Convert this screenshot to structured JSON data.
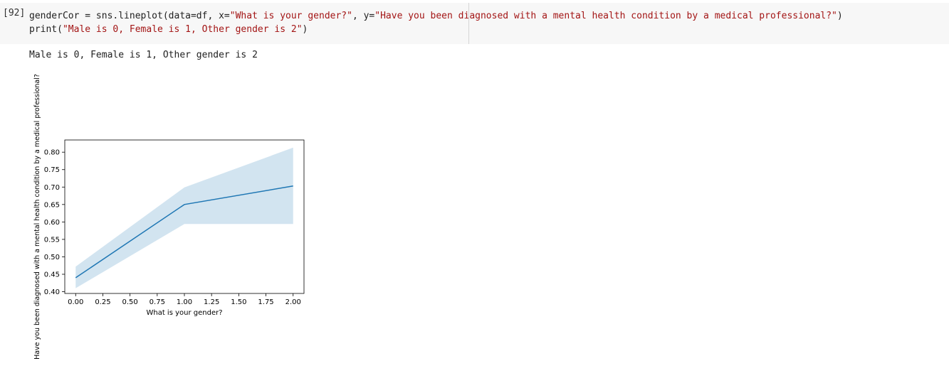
{
  "cell": {
    "prompt": "[92]",
    "code_line1_a": "genderCor = sns.lineplot(data=df, x=",
    "code_line1_b": "\"What is your gender?\"",
    "code_line1_c": ", y=",
    "code_line1_d": "\"Have you been diagnosed with a mental health condition by a medical professional?\"",
    "code_line1_e": ")",
    "code_line2_a": "print(",
    "code_line2_b": "\"Male is 0, Female is 1, Other gender is 2\"",
    "code_line2_c": ")"
  },
  "output": {
    "text": "Male is 0, Female is 1, Other gender is 2"
  },
  "chart_data": {
    "type": "line",
    "xlabel": "What is your gender?",
    "ylabel": "Have you been diagnosed with a mental health condition by a medical professional?",
    "xlim": [
      -0.1,
      2.1
    ],
    "ylim": [
      0.395,
      0.835
    ],
    "xticks": [
      "0.00",
      "0.25",
      "0.50",
      "0.75",
      "1.00",
      "1.25",
      "1.50",
      "1.75",
      "2.00"
    ],
    "yticks": [
      "0.40",
      "0.45",
      "0.50",
      "0.55",
      "0.60",
      "0.65",
      "0.70",
      "0.75",
      "0.80"
    ],
    "series": [
      {
        "x": [
          0,
          1,
          2
        ],
        "y": [
          0.44,
          0.65,
          0.703
        ],
        "ci_lower": [
          0.41,
          0.594,
          0.594
        ],
        "ci_upper": [
          0.472,
          0.699,
          0.813
        ],
        "color": "#1f77b4",
        "band_color": "#1f77b4"
      }
    ]
  }
}
